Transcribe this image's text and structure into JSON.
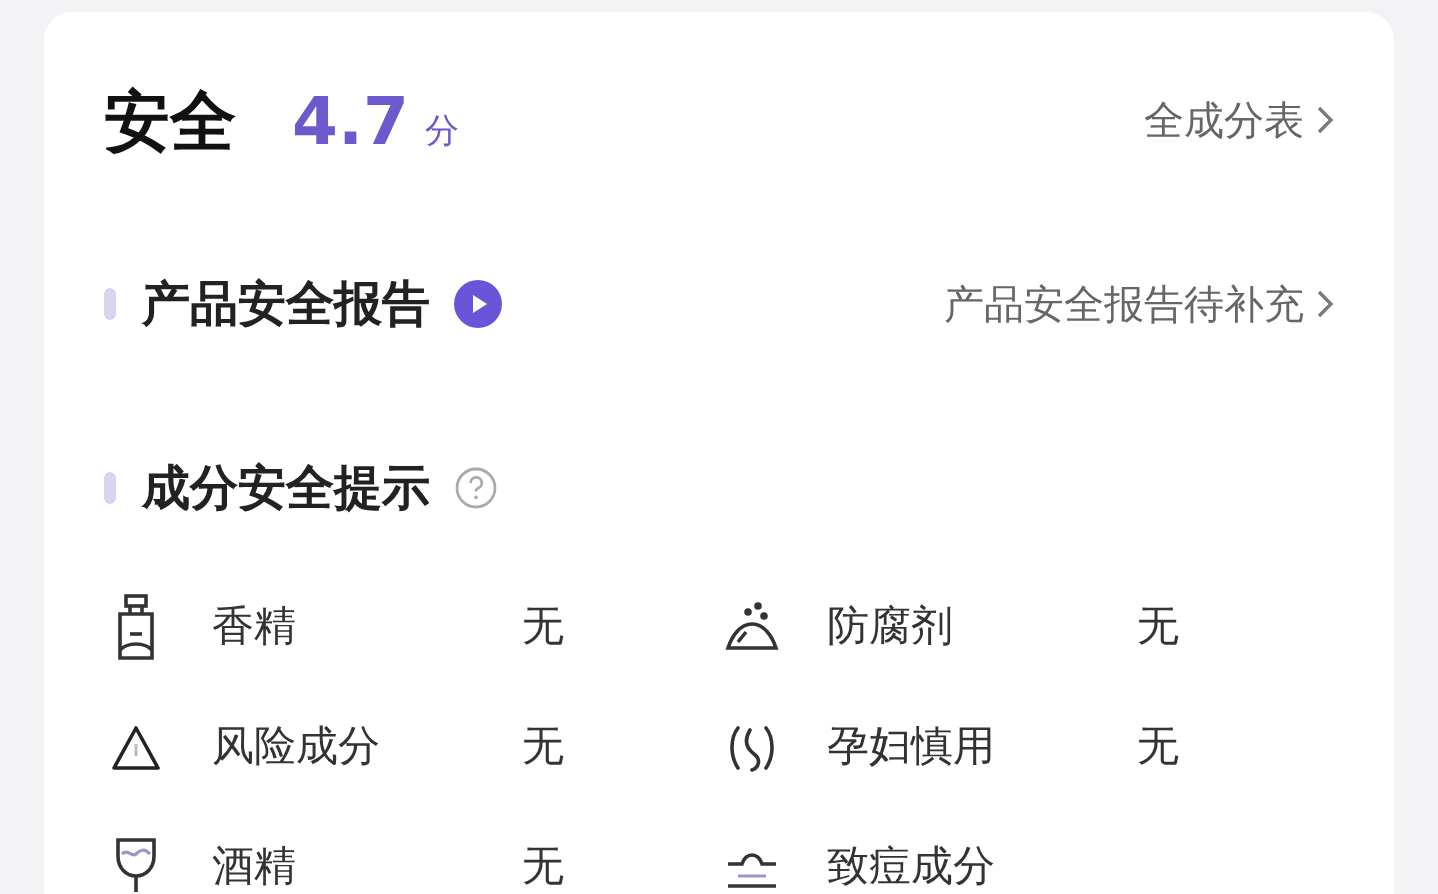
{
  "header": {
    "title": "安全",
    "score": "4.7",
    "unit": "分",
    "link": "全成分表"
  },
  "report": {
    "title": "产品安全报告",
    "link": "产品安全报告待补充"
  },
  "tips": {
    "title": "成分安全提示",
    "items": [
      {
        "label": "香精",
        "value": "无"
      },
      {
        "label": "防腐剂",
        "value": "无"
      },
      {
        "label": "风险成分",
        "value": "无"
      },
      {
        "label": "孕妇慎用",
        "value": "无"
      },
      {
        "label": "酒精",
        "value": "无"
      },
      {
        "label": "致痘成分"
      }
    ]
  }
}
